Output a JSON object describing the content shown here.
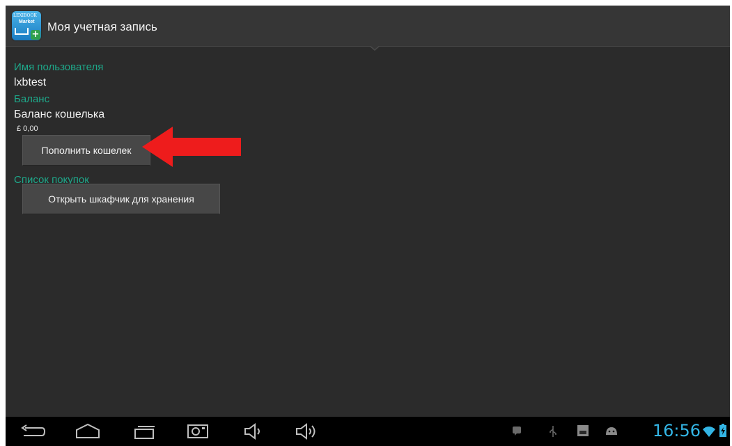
{
  "actionbar": {
    "title": "Моя учетная запись",
    "icon": "lexibook-market-app-icon",
    "icon_text": {
      "brand": "LEXIBOOK",
      "name": "Market",
      "plus": "+"
    }
  },
  "account": {
    "username_section": "Имя пользователя",
    "username": "lxbtest",
    "balance_section": "Баланс",
    "wallet_label": "Баланс кошелька",
    "wallet_value": "£ 0,00",
    "topup_button": "Пополнить кошелек",
    "purchases_section": "Список покупок",
    "locker_button": "Открыть шкафчик для хранения"
  },
  "annotation": {
    "arrow_color": "#ee1c1c"
  },
  "systembar": {
    "clock": "16:56",
    "clock_color": "#33b5e5",
    "nav_icons": [
      "back-icon",
      "home-icon",
      "recent-apps-icon",
      "screenshot-icon",
      "volume-down-icon",
      "volume-up-icon"
    ],
    "status_icons": [
      "notification-icon",
      "usb-icon",
      "sd-card-icon",
      "android-debug-icon",
      "wifi-icon",
      "battery-icon"
    ]
  },
  "colors": {
    "accent": "#1ea88a",
    "background": "#2b2b2b"
  }
}
